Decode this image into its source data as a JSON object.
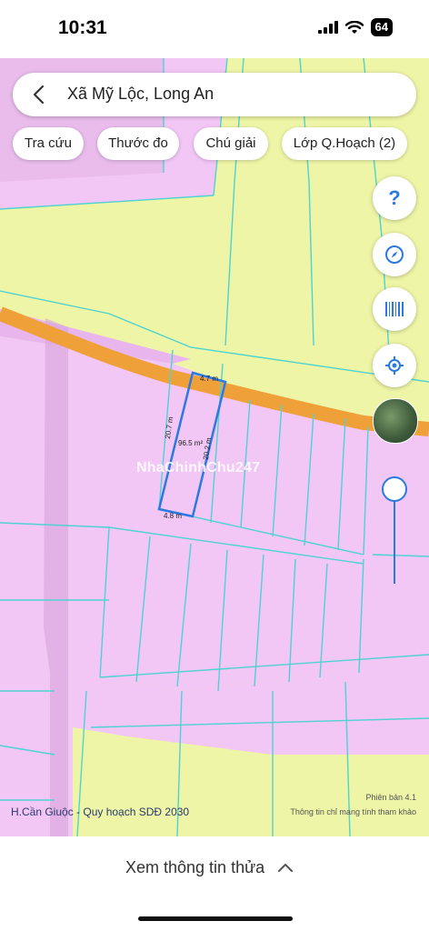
{
  "status": {
    "time": "10:31",
    "battery": "64"
  },
  "search": {
    "title": "Xã Mỹ Lộc, Long An"
  },
  "chips": [
    "Tra cứu",
    "Thước đo",
    "Chú giải",
    "Lớp Q.Hoạch (2)"
  ],
  "map_controls": {
    "help_icon": "help-icon",
    "compass_icon": "compass-icon",
    "barcode_icon": "barcode-icon",
    "location_icon": "location-icon",
    "layer_thumbnail": "satellite-layer",
    "opacity_level": 1.0
  },
  "plot": {
    "top": "4.7 m",
    "left": "20.7 m",
    "right": "20.2 m",
    "bottom": "4.8 m",
    "area": "96.5 m²"
  },
  "watermark": "NhaChinhChu247",
  "map_footer": {
    "left": "H.Cần Giuộc - Quy hoạch SDĐ 2030",
    "version": "Phiên bản 4.1",
    "note": "Thông tin chỉ mang tính tham khảo"
  },
  "bottom_panel": {
    "label": "Xem thông tin thửa"
  },
  "colors": {
    "residential_pink": "#f2c6f5",
    "agricultural_yellow": "#eef5a6",
    "road_orange": "#f0a038",
    "parcel_line": "#4fd3d0",
    "accent_blue": "#2a7ae2"
  }
}
